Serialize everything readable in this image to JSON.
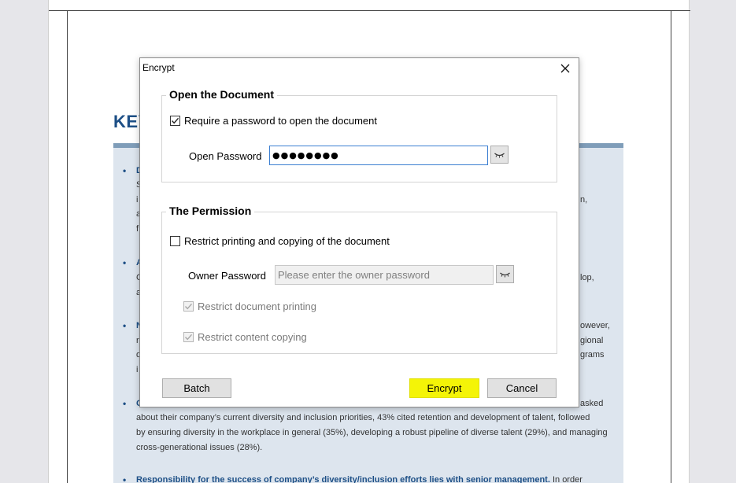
{
  "background": {
    "heading": "KEY",
    "bullet": "•",
    "fragments_left": [
      {
        "text": "D",
        "bold": true
      },
      {
        "text": "S"
      },
      {
        "text": "i"
      },
      {
        "text": "a"
      },
      {
        "text": "f"
      },
      {
        "text": "A",
        "bold": true
      },
      {
        "text": "C"
      },
      {
        "text": "a"
      },
      {
        "text": "N",
        "bold": true
      },
      {
        "text": "r"
      },
      {
        "text": "d"
      },
      {
        "text": "i"
      },
      {
        "text": "C",
        "bold": true
      }
    ],
    "fragments_right": [
      "n,",
      "lop,",
      "owever,",
      "gional",
      "grams",
      "asked"
    ],
    "lines": [
      "about their company’s current diversity and inclusion priorities, 43% cited retention and development of talent, followed",
      "by ensuring diversity in the workplace in general (35%), developing a robust pipeline of diverse talent (29%), and managing",
      "cross-generational issues (28%)."
    ],
    "last_bullet_bold": "Responsibility for the success of company’s diversity/inclusion efforts lies with senior management.",
    "last_bullet_rest": " In order"
  },
  "dialog": {
    "title": "Encrypt",
    "open_group": {
      "title": "Open the Document",
      "require_label": "Require a password to open the document",
      "require_checked": true,
      "password_label": "Open Password",
      "password_value": "●●●●●●●●"
    },
    "permission_group": {
      "title": "The Permission",
      "restrict_label": "Restrict printing and copying of the document",
      "restrict_checked": false,
      "owner_label": "Owner Password",
      "owner_placeholder": "Please enter the owner password",
      "print_label": "Restrict document printing",
      "print_checked": true,
      "copy_label": "Restrict content copying",
      "copy_checked": true
    },
    "buttons": {
      "batch": "Batch",
      "encrypt": "Encrypt",
      "cancel": "Cancel"
    },
    "colors": {
      "highlight": "#f4f407",
      "focus_border": "#3c7fd1",
      "doc_accent": "#1d4f86"
    }
  }
}
